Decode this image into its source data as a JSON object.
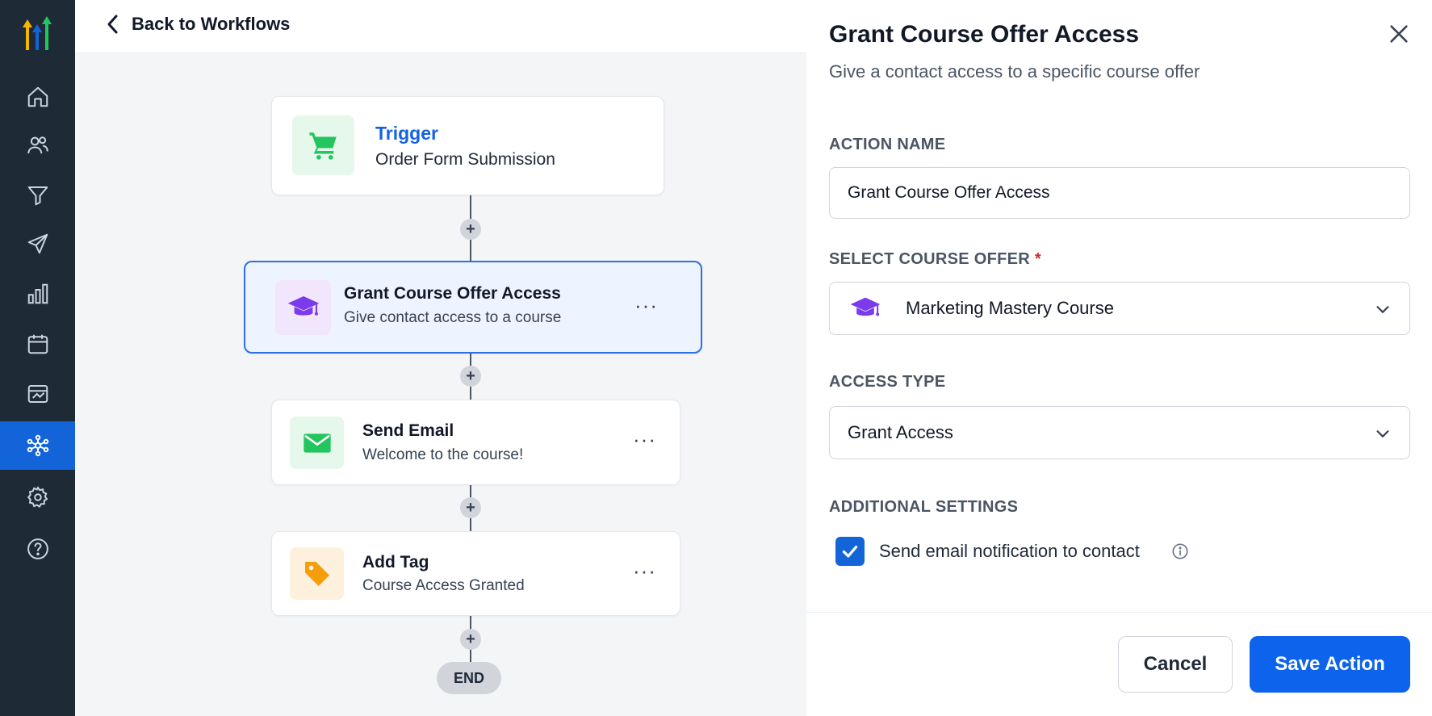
{
  "colors": {
    "sidebar_bg": "#1f2a37",
    "accent": "#1264d8",
    "trigger_link": "#1462e0",
    "primary_button": "#0d63ec"
  },
  "sidebar": {
    "items": [
      {
        "icon": "home-icon"
      },
      {
        "icon": "users-icon"
      },
      {
        "icon": "filter-icon"
      },
      {
        "icon": "send-icon"
      },
      {
        "icon": "bar-chart-icon"
      },
      {
        "icon": "calendar-icon"
      },
      {
        "icon": "payments-icon"
      },
      {
        "icon": "workflow-icon",
        "active": true
      },
      {
        "icon": "gear-icon"
      },
      {
        "icon": "help-icon"
      }
    ]
  },
  "topbar": {
    "back_label": "Back to Workflows"
  },
  "workflow": {
    "trigger": {
      "label": "Trigger",
      "name": "Order Form Submission",
      "icon": "cart-icon"
    },
    "steps": [
      {
        "title": "Grant Course Offer Access",
        "subtitle": "Give contact access to a course",
        "icon": "graduation-cap-icon"
      },
      {
        "title": "Send Email",
        "subtitle": "Welcome to the course!",
        "icon": "mail-icon"
      },
      {
        "title": "Add Tag",
        "subtitle": "Course Access Granted",
        "icon": "tag-icon"
      }
    ],
    "more_label": "···",
    "add_label": "+",
    "end_label": "END"
  },
  "panel": {
    "title": "Grant Course Offer Access",
    "subtitle": "Give a contact access to a specific course offer",
    "action_name_label": "ACTION NAME",
    "action_name_value": "Grant Course Offer Access",
    "course_offer_label": "SELECT COURSE OFFER",
    "required_mark": "*",
    "course_offer_value": "Marketing Mastery Course",
    "access_type_label": "ACCESS TYPE",
    "access_type_value": "Grant Access",
    "additional_settings_label": "ADDITIONAL SETTINGS",
    "notify_label": "Send email notification to contact",
    "notify_checked": true,
    "cancel_label": "Cancel",
    "save_label": "Save Action"
  }
}
